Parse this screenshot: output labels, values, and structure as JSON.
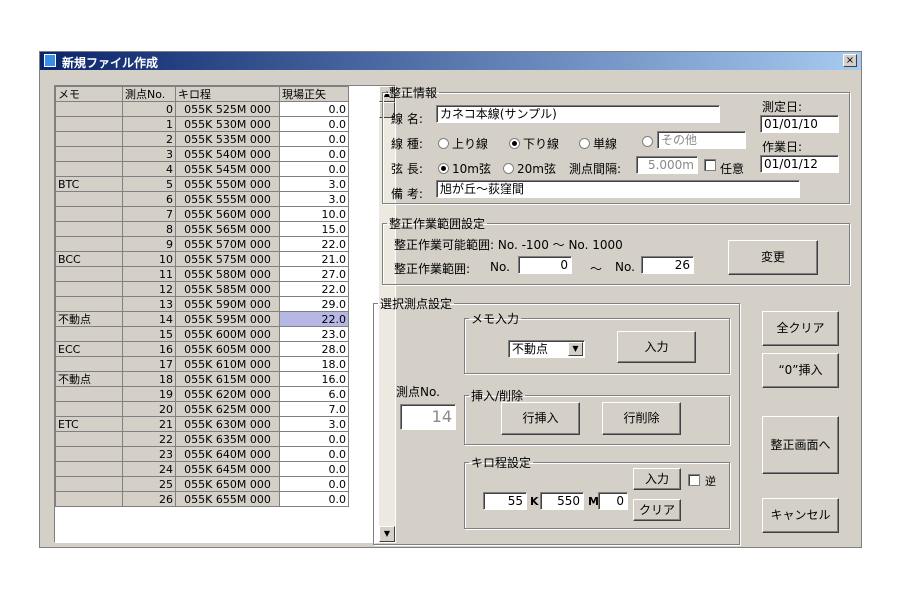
{
  "window": {
    "title": "新規ファイル作成",
    "close_glyph": "×"
  },
  "grid": {
    "headers": [
      "メモ",
      "測点No.",
      "キロ程",
      "現場正矢"
    ],
    "rows": [
      {
        "memo": "",
        "no": "0",
        "kiro": "055K 525M 000",
        "val": "0.0"
      },
      {
        "memo": "",
        "no": "1",
        "kiro": "055K 530M 000",
        "val": "0.0"
      },
      {
        "memo": "",
        "no": "2",
        "kiro": "055K 535M 000",
        "val": "0.0"
      },
      {
        "memo": "",
        "no": "3",
        "kiro": "055K 540M 000",
        "val": "0.0"
      },
      {
        "memo": "",
        "no": "4",
        "kiro": "055K 545M 000",
        "val": "0.0"
      },
      {
        "memo": "BTC",
        "no": "5",
        "kiro": "055K 550M 000",
        "val": "3.0"
      },
      {
        "memo": "",
        "no": "6",
        "kiro": "055K 555M 000",
        "val": "3.0"
      },
      {
        "memo": "",
        "no": "7",
        "kiro": "055K 560M 000",
        "val": "10.0"
      },
      {
        "memo": "",
        "no": "8",
        "kiro": "055K 565M 000",
        "val": "15.0"
      },
      {
        "memo": "",
        "no": "9",
        "kiro": "055K 570M 000",
        "val": "22.0"
      },
      {
        "memo": "BCC",
        "no": "10",
        "kiro": "055K 575M 000",
        "val": "21.0"
      },
      {
        "memo": "",
        "no": "11",
        "kiro": "055K 580M 000",
        "val": "27.0"
      },
      {
        "memo": "",
        "no": "12",
        "kiro": "055K 585M 000",
        "val": "22.0"
      },
      {
        "memo": "",
        "no": "13",
        "kiro": "055K 590M 000",
        "val": "29.0"
      },
      {
        "memo": "不動点",
        "no": "14",
        "kiro": "055K 595M 000",
        "val": "22.0"
      },
      {
        "memo": "",
        "no": "15",
        "kiro": "055K 600M 000",
        "val": "23.0"
      },
      {
        "memo": "ECC",
        "no": "16",
        "kiro": "055K 605M 000",
        "val": "28.0"
      },
      {
        "memo": "",
        "no": "17",
        "kiro": "055K 610M 000",
        "val": "18.0"
      },
      {
        "memo": "不動点",
        "no": "18",
        "kiro": "055K 615M 000",
        "val": "16.0"
      },
      {
        "memo": "",
        "no": "19",
        "kiro": "055K 620M 000",
        "val": "6.0"
      },
      {
        "memo": "",
        "no": "20",
        "kiro": "055K 625M 000",
        "val": "7.0"
      },
      {
        "memo": "ETC",
        "no": "21",
        "kiro": "055K 630M 000",
        "val": "3.0"
      },
      {
        "memo": "",
        "no": "22",
        "kiro": "055K 635M 000",
        "val": "0.0"
      },
      {
        "memo": "",
        "no": "23",
        "kiro": "055K 640M 000",
        "val": "0.0"
      },
      {
        "memo": "",
        "no": "24",
        "kiro": "055K 645M 000",
        "val": "0.0"
      },
      {
        "memo": "",
        "no": "25",
        "kiro": "055K 650M 000",
        "val": "0.0"
      },
      {
        "memo": "",
        "no": "26",
        "kiro": "055K 655M 000",
        "val": "0.0"
      }
    ],
    "selected_index": 14
  },
  "seisei": {
    "legend": "整正情報",
    "line_name_label": "線 名:",
    "line_name": "カネコ本線(サンプル)",
    "line_type_label": "線 種:",
    "line_types": [
      "上り線",
      "下り線",
      "単線",
      "その他"
    ],
    "line_type_selected": "下り線",
    "chord_label": "弦 長:",
    "chord_options": [
      "10m弦",
      "20m弦"
    ],
    "chord_selected": "10m弦",
    "interval_label": "測点間隔:",
    "interval_value": "5.000m",
    "optional_label": "任意",
    "note_label": "備 考:",
    "note": "旭が丘〜荻窪間",
    "measure_date_label": "測定日:",
    "measure_date": "01/01/10",
    "work_date_label": "作業日:",
    "work_date": "01/01/12"
  },
  "range": {
    "legend": "整正作業範囲設定",
    "possible_text": "整正作業可能範囲:  No. -100 〜 No. 1000",
    "range_label": "整正作業範囲:",
    "no_label": "No.",
    "from": "0",
    "tilde": "〜",
    "to": "26",
    "change_button": "変更"
  },
  "select": {
    "legend": "選択測点設定",
    "memo_legend": "メモ入力",
    "memo_value": "不動点",
    "memo_input_button": "入力",
    "measure_no_label": "測点No.",
    "measure_no": "14",
    "row_legend": "挿入/削除",
    "insert_row_button": "行挿入",
    "delete_row_button": "行削除",
    "kiro_legend": "キロ程設定",
    "kiro_k_value": "55",
    "k_label": "K",
    "kiro_m_value": "550",
    "m_label": "M",
    "kiro_mm_value": "0",
    "kiro_input_button": "入力",
    "reverse_label": "逆",
    "clear_button": "クリア"
  },
  "side_buttons": {
    "clear_all": "全クリア",
    "insert_zero": "“0”挿入",
    "to_seisei": "整正画面へ",
    "cancel": "キャンセル"
  }
}
